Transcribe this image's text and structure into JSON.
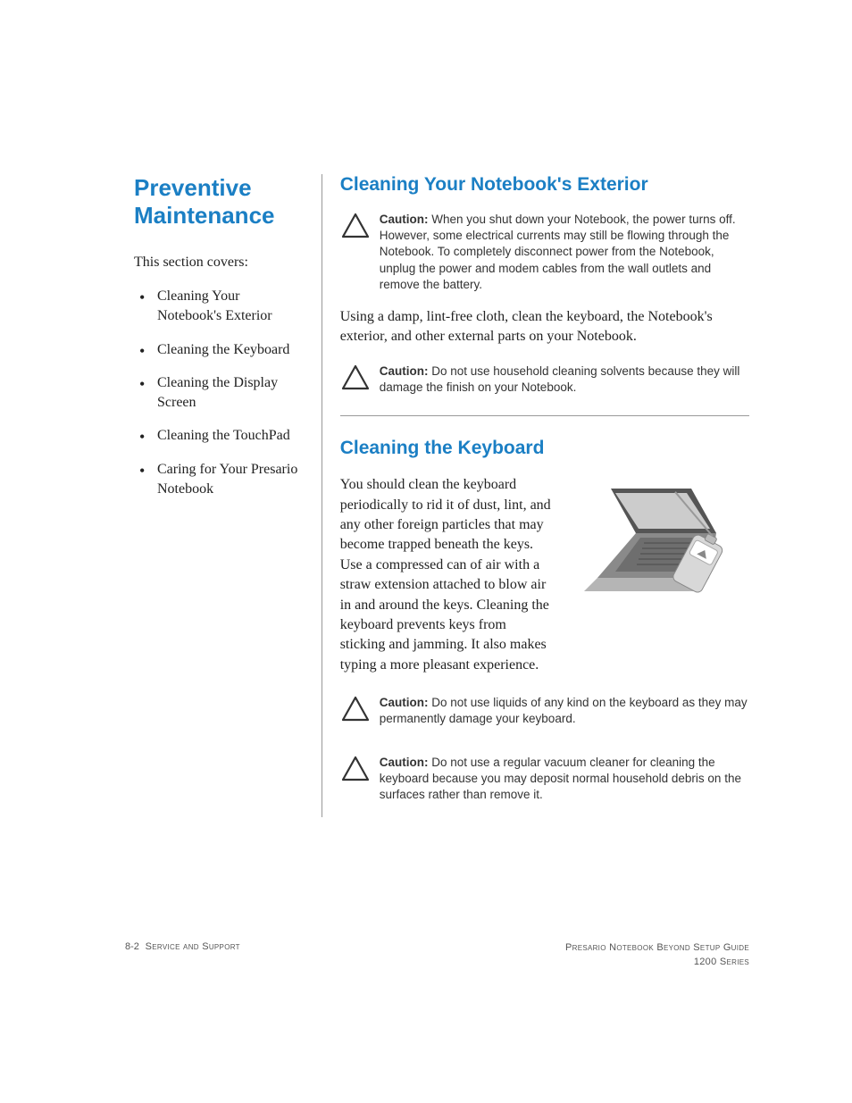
{
  "sidebar": {
    "chapter_title": "Preventive Maintenance",
    "intro": "This section covers:",
    "items": [
      "Cleaning Your Notebook's Exterior",
      "Cleaning the Keyboard",
      "Cleaning the Display Screen",
      "Cleaning the TouchPad",
      "Caring for Your Presario Notebook"
    ]
  },
  "section1": {
    "title": "Cleaning Your Notebook's Exterior",
    "caution1_label": "Caution:",
    "caution1_text": " When you shut down your Notebook, the power turns off. However, some electrical currents may still be flowing through the Notebook. To completely disconnect power from the Notebook, unplug the power and modem cables from the wall outlets and remove the battery.",
    "body": "Using a damp, lint-free cloth, clean the keyboard, the Notebook's exterior, and other external parts on your Notebook.",
    "caution2_label": "Caution:",
    "caution2_text": " Do not use household cleaning solvents because they will damage the finish on your Notebook."
  },
  "section2": {
    "title": "Cleaning the Keyboard",
    "body": "You should clean the keyboard periodically to rid it of dust, lint, and any other foreign particles that may become trapped beneath the keys. Use a compressed can of air with a straw extension attached to blow air in and around the keys. Cleaning the keyboard prevents keys from sticking and jamming. It also makes typing a more pleasant experience.",
    "caution1_label": "Caution:",
    "caution1_text": " Do not use liquids of any kind on the keyboard as they may permanently damage your keyboard.",
    "caution2_label": "Caution:",
    "caution2_text": " Do not use a regular vacuum cleaner for cleaning the keyboard because you may deposit normal household debris on the surfaces rather than remove it."
  },
  "footer": {
    "page_num": "8-2",
    "left_label": "Service and Support",
    "right_line1": "Presario Notebook Beyond Setup Guide",
    "right_line2": "1200 Series"
  }
}
